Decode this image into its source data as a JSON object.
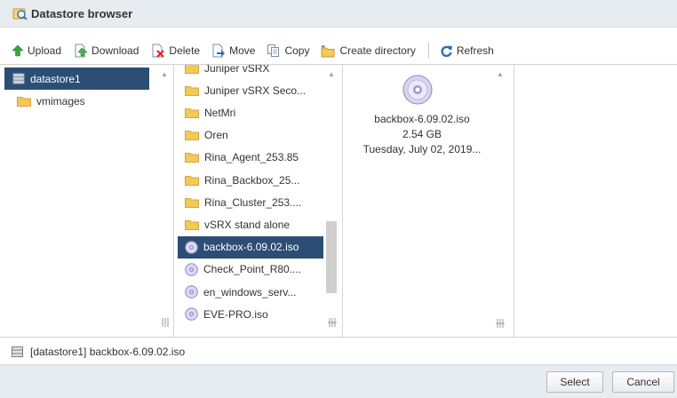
{
  "window": {
    "title": "Datastore browser",
    "title_icon": "datastore-browser-icon"
  },
  "toolbar": {
    "upload": "Upload",
    "download": "Download",
    "delete": "Delete",
    "move": "Move",
    "copy": "Copy",
    "create_directory": "Create directory",
    "refresh": "Refresh"
  },
  "tree": [
    {
      "label": "datastore1",
      "icon": "datastore-icon",
      "selected": true
    },
    {
      "label": "vmimages",
      "icon": "folder-icon",
      "selected": false
    }
  ],
  "files": [
    {
      "label": "Juniper vSRX",
      "icon": "folder-icon"
    },
    {
      "label": "Juniper vSRX Seco...",
      "icon": "folder-icon"
    },
    {
      "label": "NetMri",
      "icon": "folder-icon"
    },
    {
      "label": "Oren",
      "icon": "folder-icon"
    },
    {
      "label": "Rina_Agent_253.85",
      "icon": "folder-icon"
    },
    {
      "label": "Rina_Backbox_25...",
      "icon": "folder-icon"
    },
    {
      "label": "Rina_Cluster_253....",
      "icon": "folder-icon"
    },
    {
      "label": "vSRX stand alone",
      "icon": "folder-icon"
    },
    {
      "label": "backbox-6.09.02.iso",
      "icon": "disc-icon",
      "selected": true
    },
    {
      "label": "Check_Point_R80....",
      "icon": "disc-icon"
    },
    {
      "label": "en_windows_serv...",
      "icon": "disc-icon"
    },
    {
      "label": "EVE-PRO.iso",
      "icon": "disc-icon"
    }
  ],
  "preview": {
    "icon": "disc-icon",
    "name": "backbox-6.09.02.iso",
    "size": "2.54 GB",
    "date": "Tuesday, July 02, 2019..."
  },
  "path": {
    "icon": "datastore-icon",
    "text": "[datastore1] backbox-6.09.02.iso"
  },
  "footer": {
    "select": "Select",
    "cancel": "Cancel"
  },
  "colors": {
    "selection": "#2c4d74",
    "header_bg": "#e7ecf1",
    "accent_blue": "#2e6db4"
  }
}
